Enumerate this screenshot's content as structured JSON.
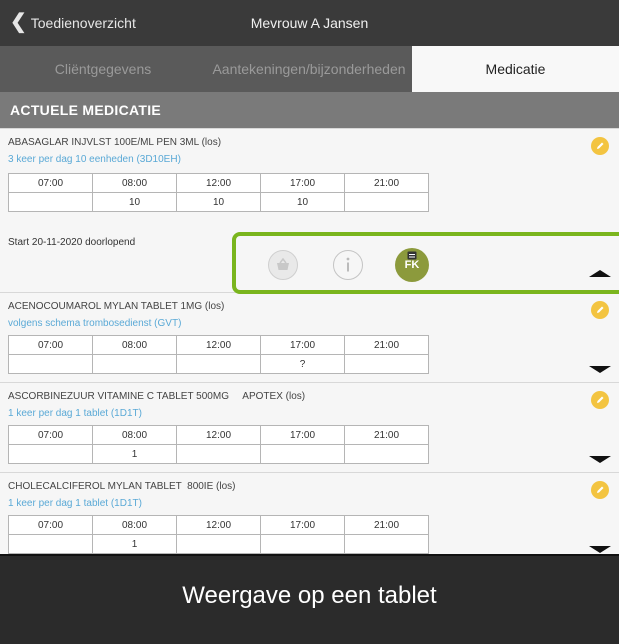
{
  "header": {
    "back_label": "Toedienoverzicht",
    "title": "Mevrouw A Jansen"
  },
  "tabs": [
    {
      "label": "Cliëntgegevens",
      "active": false
    },
    {
      "label": "Aantekeningen/bijzonderheden",
      "active": false
    },
    {
      "label": "Medicatie",
      "active": true
    }
  ],
  "section_title": "ACTUELE MEDICATIE",
  "medications": [
    {
      "name": "ABASAGLAR INJVLST 100E/ML PEN 3ML (los)",
      "dosage": "3 keer per dag 10 eenheden (3D10EH)",
      "times": [
        "07:00",
        "08:00",
        "12:00",
        "17:00",
        "21:00"
      ],
      "doses": [
        "",
        "10",
        "10",
        "10",
        ""
      ],
      "start": "Start 20-11-2020 doorlopend",
      "expanded": true,
      "actions": [
        "basket-icon",
        "info-icon",
        "fk-icon"
      ],
      "fk_label": "FK"
    },
    {
      "name": "ACENOCOUMAROL MYLAN TABLET 1MG (los)",
      "dosage": "volgens schema trombosedienst (GVT)",
      "times": [
        "07:00",
        "08:00",
        "12:00",
        "17:00",
        "21:00"
      ],
      "doses": [
        "",
        "",
        "",
        "?",
        ""
      ],
      "expanded": false
    },
    {
      "name": "ASCORBINEZUUR VITAMINE C TABLET 500MG     APOTEX (los)",
      "dosage": "1 keer per dag 1 tablet (1D1T)",
      "times": [
        "07:00",
        "08:00",
        "12:00",
        "17:00",
        "21:00"
      ],
      "doses": [
        "",
        "1",
        "",
        "",
        ""
      ],
      "expanded": false
    },
    {
      "name": "CHOLECALCIFEROL MYLAN TABLET  800IE (los)",
      "dosage": "1 keer per dag 1 tablet (1D1T)",
      "times": [
        "07:00",
        "08:00",
        "12:00",
        "17:00",
        "21:00"
      ],
      "doses": [
        "",
        "1",
        "",
        "",
        ""
      ],
      "expanded": false
    }
  ],
  "overlay_caption": "Weergave op een tablet",
  "colors": {
    "accent_green": "#7ab51d",
    "dosage_blue": "#5aa9d6",
    "edit_yellow": "#f3c441",
    "header_dark": "#3a3a3a"
  }
}
